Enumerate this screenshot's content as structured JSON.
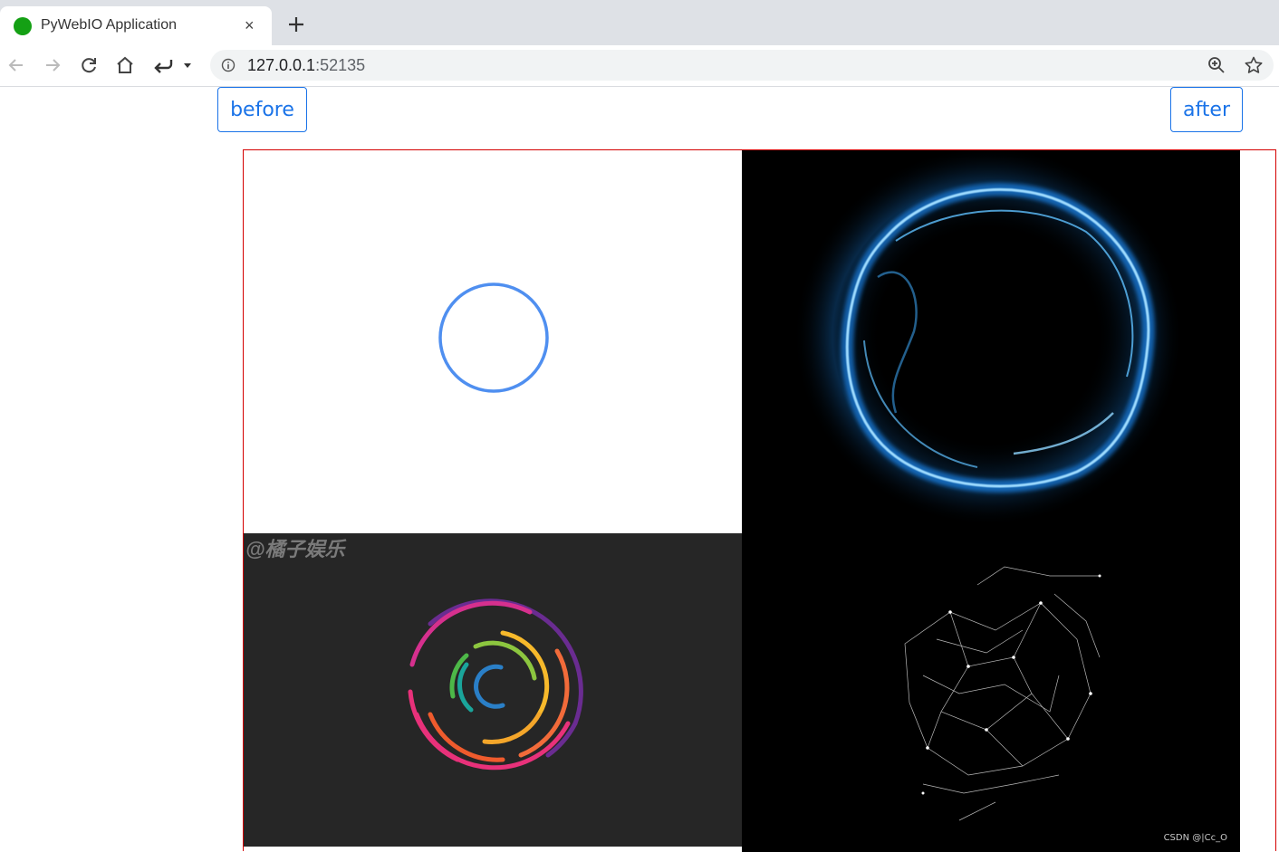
{
  "browser": {
    "tab_title": "PyWebIO Application",
    "tab_close": "×",
    "url_host": "127.0.0.1",
    "url_port": ":52135",
    "icons": [
      "back-icon",
      "forward-icon",
      "reload-icon",
      "home-icon",
      "undo-icon",
      "dropdown-icon",
      "info-icon",
      "zoom-icon",
      "star-icon",
      "new-tab-icon"
    ]
  },
  "page": {
    "before_label": "before",
    "after_label": "after",
    "accent_color": "#1a73e8",
    "border_color": "#d40000",
    "panels": [
      {
        "name": "loading-circle-gif"
      },
      {
        "name": "blue-energy-ring-gif"
      },
      {
        "name": "rainbow-arcs-gif",
        "watermark": "@橘子娱乐"
      },
      {
        "name": "particle-network-gif"
      }
    ],
    "footer_watermark": "CSDN @|Cc_O"
  }
}
